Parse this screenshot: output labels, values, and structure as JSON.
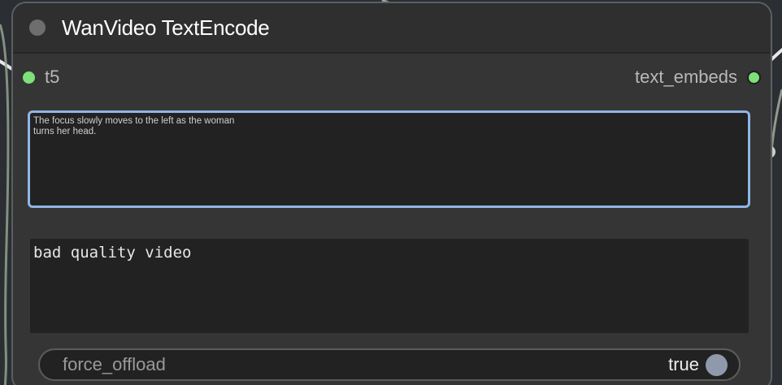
{
  "node": {
    "title": "WanVideo TextEncode",
    "colors": {
      "slot": "#7de07a",
      "focus_border": "#8fb6e6",
      "toggle_knob": "#8e9aab"
    },
    "inputs": [
      {
        "label": "t5"
      }
    ],
    "outputs": [
      {
        "label": "text_embeds"
      }
    ],
    "positive_prompt": "The focus slowly moves to the left as the woman\nturns her head.",
    "negative_prompt": "bad quality video",
    "toggle": {
      "label": "force_offload",
      "value": "true"
    }
  }
}
